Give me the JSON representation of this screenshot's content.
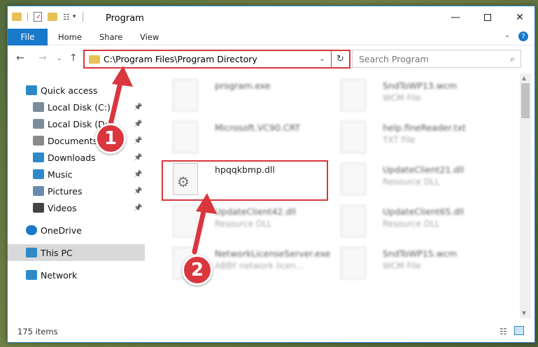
{
  "window": {
    "title": "Program"
  },
  "ribbon": {
    "file": "File",
    "tabs": [
      "Home",
      "Share",
      "View"
    ]
  },
  "address": {
    "path": "C:\\Program Files\\Program Directory",
    "refresh_icon": "refresh-icon"
  },
  "search": {
    "placeholder": "Search Program"
  },
  "sidebar": {
    "items": [
      {
        "label": "Quick access",
        "icon": "star-icon"
      },
      {
        "label": "Local Disk (C:)",
        "icon": "drive-icon",
        "pinned": true
      },
      {
        "label": "Local Disk (D:)",
        "icon": "drive-icon",
        "pinned": true
      },
      {
        "label": "Documents",
        "icon": "documents-icon",
        "pinned": true
      },
      {
        "label": "Downloads",
        "icon": "download-icon",
        "pinned": true
      },
      {
        "label": "Music",
        "icon": "music-icon",
        "pinned": true
      },
      {
        "label": "Pictures",
        "icon": "pictures-icon",
        "pinned": true
      },
      {
        "label": "Videos",
        "icon": "video-icon",
        "pinned": true
      },
      {
        "label": "OneDrive",
        "icon": "cloud-icon"
      },
      {
        "label": "This PC",
        "icon": "pc-icon",
        "selected": true
      },
      {
        "label": "Network",
        "icon": "network-icon"
      }
    ]
  },
  "files": {
    "left": [
      {
        "name": "program.exe",
        "type": ""
      },
      {
        "name": "Microsoft.VC90.CRT",
        "type": ""
      },
      {
        "name": "hpqqkbmp.dll",
        "type": ""
      },
      {
        "name": "UpdateClient42.dll",
        "type": "Resource DLL"
      },
      {
        "name": "NetworkLicenseServer.exe",
        "type": "ABBY network licen..."
      }
    ],
    "right": [
      {
        "name": "SndToWP13.wcm",
        "type": "WCM File"
      },
      {
        "name": "help.fineReader.txt",
        "type": "TXT File"
      },
      {
        "name": "UpdateClient21.dll",
        "type": "Resource DLL"
      },
      {
        "name": "UpdateClient65.dll",
        "type": "Resource DLL"
      },
      {
        "name": "SndToWP15.wcm",
        "type": "WCM File"
      }
    ]
  },
  "status": {
    "count": "175 items"
  },
  "annotations": {
    "step1": "1",
    "step2": "2"
  },
  "colors": {
    "accent": "#1979ca",
    "highlight": "#d9363e"
  }
}
